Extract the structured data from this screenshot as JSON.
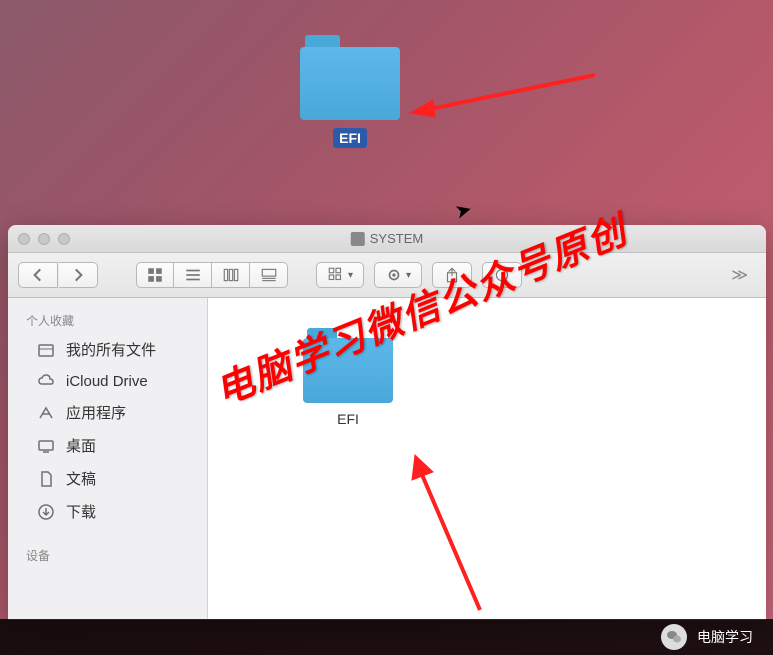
{
  "desktop": {
    "folder_name": "EFI"
  },
  "watermark_text": "电脑学习微信公众号原创",
  "finder": {
    "window_title": "SYSTEM",
    "sidebar": {
      "favorites_header": "个人收藏",
      "devices_header": "设备",
      "items": [
        {
          "label": "我的所有文件",
          "icon": "all-files"
        },
        {
          "label": "iCloud Drive",
          "icon": "cloud"
        },
        {
          "label": "应用程序",
          "icon": "applications"
        },
        {
          "label": "桌面",
          "icon": "desktop"
        },
        {
          "label": "文稿",
          "icon": "documents"
        },
        {
          "label": "下载",
          "icon": "downloads"
        }
      ]
    },
    "content": {
      "folders": [
        {
          "name": "EFI"
        }
      ]
    }
  },
  "bottom_bar": {
    "account_name": "电脑学习"
  }
}
